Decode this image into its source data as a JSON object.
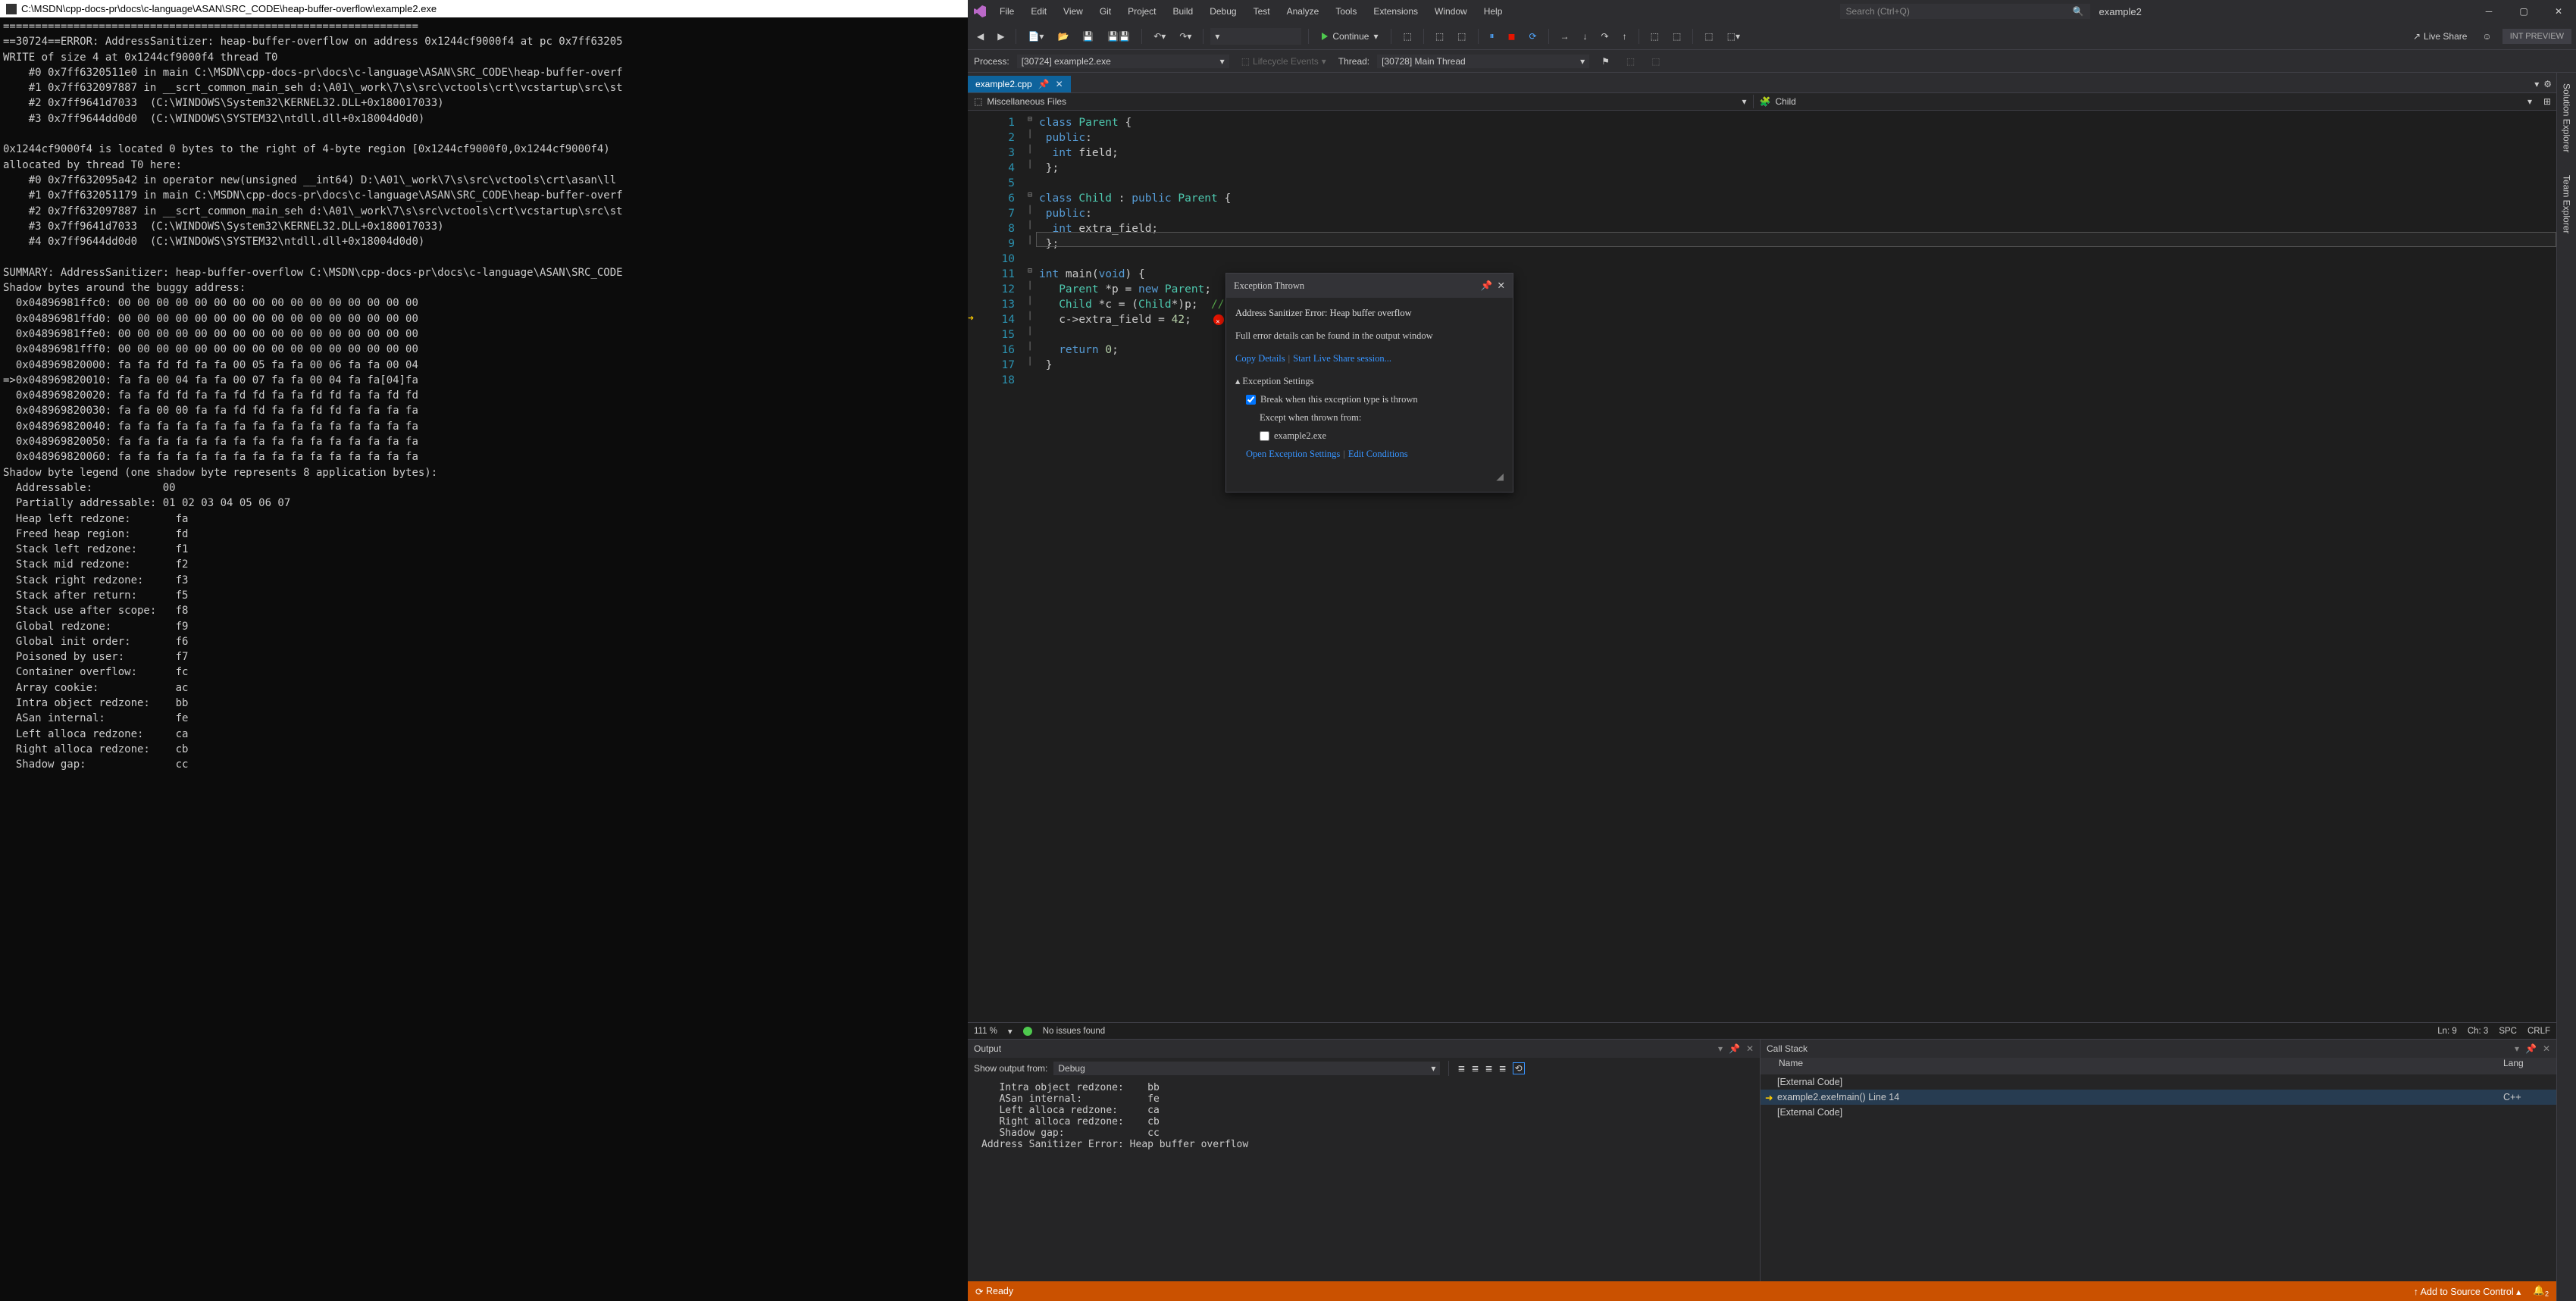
{
  "console": {
    "title": "C:\\MSDN\\cpp-docs-pr\\docs\\c-language\\ASAN\\SRC_CODE\\heap-buffer-overflow\\example2.exe",
    "body": "=================================================================\n==30724==ERROR: AddressSanitizer: heap-buffer-overflow on address 0x1244cf9000f4 at pc 0x7ff63205\nWRITE of size 4 at 0x1244cf9000f4 thread T0\n    #0 0x7ff6320511e0 in main C:\\MSDN\\cpp-docs-pr\\docs\\c-language\\ASAN\\SRC_CODE\\heap-buffer-overf\n    #1 0x7ff632097887 in __scrt_common_main_seh d:\\A01\\_work\\7\\s\\src\\vctools\\crt\\vcstartup\\src\\st\n    #2 0x7ff9641d7033  (C:\\WINDOWS\\System32\\KERNEL32.DLL+0x180017033)\n    #3 0x7ff9644dd0d0  (C:\\WINDOWS\\SYSTEM32\\ntdll.dll+0x18004d0d0)\n\n0x1244cf9000f4 is located 0 bytes to the right of 4-byte region [0x1244cf9000f0,0x1244cf9000f4)\nallocated by thread T0 here:\n    #0 0x7ff632095a42 in operator new(unsigned __int64) D:\\A01\\_work\\7\\s\\src\\vctools\\crt\\asan\\ll\n    #1 0x7ff632051179 in main C:\\MSDN\\cpp-docs-pr\\docs\\c-language\\ASAN\\SRC_CODE\\heap-buffer-overf\n    #2 0x7ff632097887 in __scrt_common_main_seh d:\\A01\\_work\\7\\s\\src\\vctools\\crt\\vcstartup\\src\\st\n    #3 0x7ff9641d7033  (C:\\WINDOWS\\System32\\KERNEL32.DLL+0x180017033)\n    #4 0x7ff9644dd0d0  (C:\\WINDOWS\\SYSTEM32\\ntdll.dll+0x18004d0d0)\n\nSUMMARY: AddressSanitizer: heap-buffer-overflow C:\\MSDN\\cpp-docs-pr\\docs\\c-language\\ASAN\\SRC_CODE\nShadow bytes around the buggy address:\n  0x04896981ffc0: 00 00 00 00 00 00 00 00 00 00 00 00 00 00 00 00\n  0x04896981ffd0: 00 00 00 00 00 00 00 00 00 00 00 00 00 00 00 00\n  0x04896981ffe0: 00 00 00 00 00 00 00 00 00 00 00 00 00 00 00 00\n  0x04896981fff0: 00 00 00 00 00 00 00 00 00 00 00 00 00 00 00 00\n  0x048969820000: fa fa fd fd fa fa 00 05 fa fa 00 06 fa fa 00 04\n=>0x048969820010: fa fa 00 04 fa fa 00 07 fa fa 00 04 fa fa[04]fa\n  0x048969820020: fa fa fd fd fa fa fd fd fa fa fd fd fa fa fd fd\n  0x048969820030: fa fa 00 00 fa fa fd fd fa fa fd fd fa fa fa fa\n  0x048969820040: fa fa fa fa fa fa fa fa fa fa fa fa fa fa fa fa\n  0x048969820050: fa fa fa fa fa fa fa fa fa fa fa fa fa fa fa fa\n  0x048969820060: fa fa fa fa fa fa fa fa fa fa fa fa fa fa fa fa\nShadow byte legend (one shadow byte represents 8 application bytes):\n  Addressable:           00\n  Partially addressable: 01 02 03 04 05 06 07\n  Heap left redzone:       fa\n  Freed heap region:       fd\n  Stack left redzone:      f1\n  Stack mid redzone:       f2\n  Stack right redzone:     f3\n  Stack after return:      f5\n  Stack use after scope:   f8\n  Global redzone:          f9\n  Global init order:       f6\n  Poisoned by user:        f7\n  Container overflow:      fc\n  Array cookie:            ac\n  Intra object redzone:    bb\n  ASan internal:           fe\n  Left alloca redzone:     ca\n  Right alloca redzone:    cb\n  Shadow gap:              cc"
  },
  "menu": [
    "File",
    "Edit",
    "View",
    "Git",
    "Project",
    "Build",
    "Debug",
    "Test",
    "Analyze",
    "Tools",
    "Extensions",
    "Window",
    "Help"
  ],
  "search_placeholder": "Search (Ctrl+Q)",
  "solution_name": "example2",
  "continue_label": "Continue",
  "live_share_label": "Live Share",
  "int_preview": "INT PREVIEW",
  "debug": {
    "process_label": "Process:",
    "process_value": "[30724] example2.exe",
    "lifecycle": "Lifecycle Events",
    "thread_label": "Thread:",
    "thread_value": "[30728] Main Thread"
  },
  "side_tabs": [
    "Solution Explorer",
    "Team Explorer"
  ],
  "doc_tab": "example2.cpp",
  "nav_left": "Miscellaneous Files",
  "nav_right": "Child",
  "code_lines": [
    "class Parent {",
    " public:",
    "  int field;",
    " };",
    "",
    "class Child : public Parent {",
    " public:",
    "  int extra_field;",
    " };",
    "",
    "int main(void) {",
    "   Parent *p = new Parent;",
    "   Child *c = (Child*)p;  // Intentional error here!",
    "   c->extra_field = 42;",
    "",
    "   return 0;",
    " }",
    ""
  ],
  "exception": {
    "title": "Exception Thrown",
    "message": "Address Sanitizer Error: Heap buffer overflow",
    "details": "Full error details can be found in the output window",
    "copy": "Copy Details",
    "liveshare": "Start Live Share session...",
    "settings_header": "Exception Settings",
    "break_when": "Break when this exception type is thrown",
    "except_when": "Except when thrown from:",
    "except_item": "example2.exe",
    "open_settings": "Open Exception Settings",
    "edit_cond": "Edit Conditions"
  },
  "status": {
    "zoom": "111 %",
    "issues": "No issues found",
    "ln": "Ln: 9",
    "ch": "Ch: 3",
    "spc": "SPC",
    "crlf": "CRLF"
  },
  "output": {
    "title": "Output",
    "show_from": "Show output from:",
    "source": "Debug",
    "body": "   Intra object redzone:    bb\n   ASan internal:           fe\n   Left alloca redzone:     ca\n   Right alloca redzone:    cb\n   Shadow gap:              cc\nAddress Sanitizer Error: Heap buffer overflow"
  },
  "callstack": {
    "title": "Call Stack",
    "col_name": "Name",
    "col_lang": "Lang",
    "rows": [
      {
        "name": "[External Code]",
        "lang": ""
      },
      {
        "name": "example2.exe!main() Line 14",
        "lang": "C++"
      },
      {
        "name": "[External Code]",
        "lang": ""
      }
    ]
  },
  "statusbar": {
    "ready": "Ready",
    "add_sc": "Add to Source Control"
  }
}
